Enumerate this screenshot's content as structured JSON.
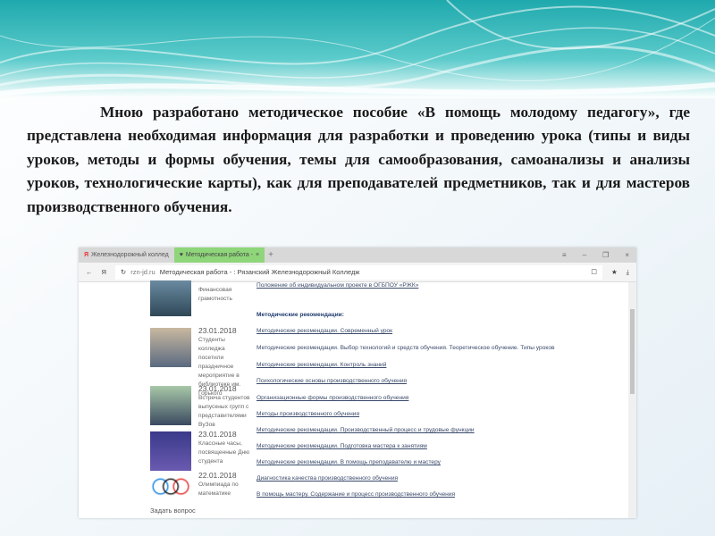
{
  "slide": {
    "paragraph": "Мною разработано методическое пособие «В помощь молодому педагогу», где представлена необходимая информация для разработки и проведению урока (типы и  виды уроков, методы и формы обучения, темы для самообразования, самоанализы и анализы уроков, технологические карты), как для преподавателей предметников, так и для мастеров производственного обучения."
  },
  "browser": {
    "tabs": [
      {
        "label": "Железнодорожный коллед"
      },
      {
        "label": "Методическая работа -"
      }
    ],
    "tab_close": "×",
    "new_tab": "+",
    "window_controls": [
      "≡",
      "–",
      "❐",
      "×"
    ],
    "address": {
      "host": "rzn-jd.ru",
      "title": "Методическая работа - : Рязанский Железнодорожный Колледж"
    },
    "news": [
      {
        "date": "",
        "text": "Финансовая грамотность"
      },
      {
        "date": "23.01.2018",
        "text": "Студенты колледжа посетили праздничное мероприятие в библиотеке им. Горького"
      },
      {
        "date": "23.01.2018",
        "text": "Встреча студентов выпускных групп с представителями ВуЗов"
      },
      {
        "date": "23.01.2018",
        "text": "Классные часы, посвященные Дню студента"
      },
      {
        "date": "22.01.2018",
        "text": "Олимпиада по математике"
      }
    ],
    "ask_question": "Задать вопрос",
    "links": [
      "Положение об индивидуальном проекте в ОГБПОУ «РЖК»",
      "Методические рекомендации:",
      "Методические рекомендации. Современный урок",
      "Методические рекомендации. Выбор технологий и средств обучения. Теоретическое обучение. Типы уроков",
      "Методические рекомендации. Контроль знаний",
      "Психологические основы производственного обучения",
      "Организационные формы производственного обучения",
      "Методы производственного обучения",
      "Методические рекомендации. Производственный процесс и трудовые функции",
      "Методические рекомендации. Подготовка мастера к занятиям",
      "Методические рекомендации. В помощь преподавателю и мастеру",
      "Диагностика качества производственного обучения",
      "В помощь мастеру. Содержание и процесс производственного обучения"
    ]
  },
  "colors": {
    "header_teal": "#2bb5b8",
    "active_tab": "#8fd67a",
    "link": "#3a4a6a"
  }
}
